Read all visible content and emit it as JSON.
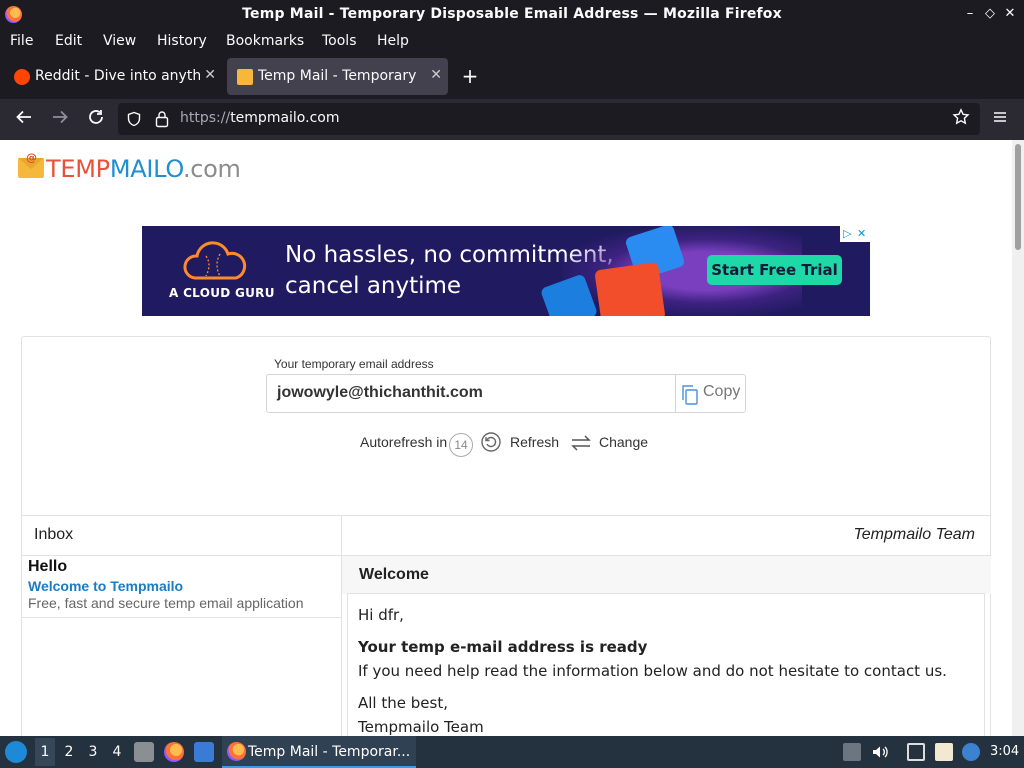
{
  "window": {
    "title": "Temp Mail - Temporary Disposable Email Address — Mozilla Firefox",
    "controls": {
      "minimize": "–",
      "restore": "◇",
      "close": "✕"
    }
  },
  "menu": [
    "File",
    "Edit",
    "View",
    "History",
    "Bookmarks",
    "Tools",
    "Help"
  ],
  "tabs": [
    {
      "label": "Reddit - Dive into anythin",
      "favicon": "reddit-icon",
      "active": false
    },
    {
      "label": "Temp Mail - Temporary Di",
      "favicon": "tempmail-icon",
      "active": true
    }
  ],
  "newtab_symbol": "+",
  "nav": {
    "url_scheme": "https://",
    "url_host": "tempmailo.com"
  },
  "site": {
    "logo": {
      "part1": "TEMP",
      "part2": "MAILO",
      "part3": ".com",
      "at": "@"
    },
    "ad": {
      "brand": "A CLOUD GURU",
      "headline_line1": "No hassles, no commitment,",
      "headline_line2": "cancel anytime",
      "cta": "Start Free Trial",
      "adchoices": "▷",
      "close": "✕"
    },
    "email_label": "Your temporary email address",
    "email_address": "jowowyle@thichanthit.com",
    "copy_label": "Copy",
    "autorefresh_label": "Autorefresh in",
    "autorefresh_seconds": "14",
    "refresh_label": "Refresh",
    "change_label": "Change",
    "inbox_title": "Inbox",
    "sender_title": "Tempmailo Team",
    "messages": [
      {
        "from": "Hello",
        "subject": "Welcome to Tempmailo",
        "preview": "Free, fast and secure temp email application"
      }
    ],
    "reader": {
      "subject": "Welcome",
      "greeting": "Hi dfr,",
      "heading": "Your temp e-mail address is ready",
      "body": "If you need help read the information below and do not hesitate to contact us.",
      "signoff": "All the best,",
      "signature": "Tempmailo Team"
    }
  },
  "taskbar": {
    "workspaces": [
      "1",
      "2",
      "3",
      "4"
    ],
    "active_workspace": "1",
    "task_label": "Temp Mail - Temporar...",
    "clock": "3:04"
  }
}
